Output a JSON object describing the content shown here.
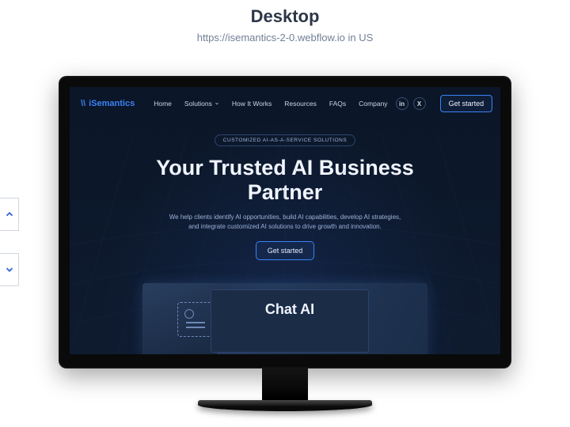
{
  "header": {
    "device_label": "Desktop",
    "url_text": "https://isemantics-2-0.webflow.io in US"
  },
  "site": {
    "brand": "iSemantics",
    "nav": {
      "items": [
        {
          "label": "Home",
          "has_dropdown": false
        },
        {
          "label": "Solutions",
          "has_dropdown": true
        },
        {
          "label": "How It Works",
          "has_dropdown": false
        },
        {
          "label": "Resources",
          "has_dropdown": false
        },
        {
          "label": "FAQs",
          "has_dropdown": false
        },
        {
          "label": "Company",
          "has_dropdown": false
        }
      ],
      "socials": {
        "linkedin_glyph": "in",
        "x_glyph": "X"
      },
      "cta_label": "Get started"
    },
    "hero": {
      "eyebrow": "CUSTOMIZED AI-AS-A-SERVICE SOLUTIONS",
      "title_line1": "Your Trusted AI Business",
      "title_line2": "Partner",
      "subtitle": "We help clients identify AI opportunities, build AI capabilities, develop AI strategies, and integrate customized AI solutions to drive growth and innovation.",
      "cta_label": "Get started",
      "media_label": "Chat AI"
    }
  },
  "colors": {
    "accent": "#3b82f6",
    "bg_dark": "#0e1a2e"
  }
}
